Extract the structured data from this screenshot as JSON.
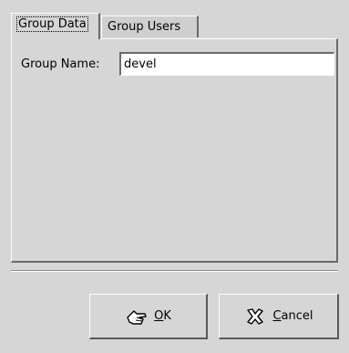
{
  "tabs": [
    {
      "label": "Group Data",
      "active": true
    },
    {
      "label": "Group Users",
      "active": false
    }
  ],
  "form": {
    "group_name_label": "Group Name:",
    "group_name_value": "devel"
  },
  "buttons": {
    "ok": {
      "mnemonic": "O",
      "rest": "K",
      "icon": "ok-hand-icon"
    },
    "cancel": {
      "mnemonic": "C",
      "rest": "ancel",
      "icon": "cancel-x-icon"
    }
  }
}
